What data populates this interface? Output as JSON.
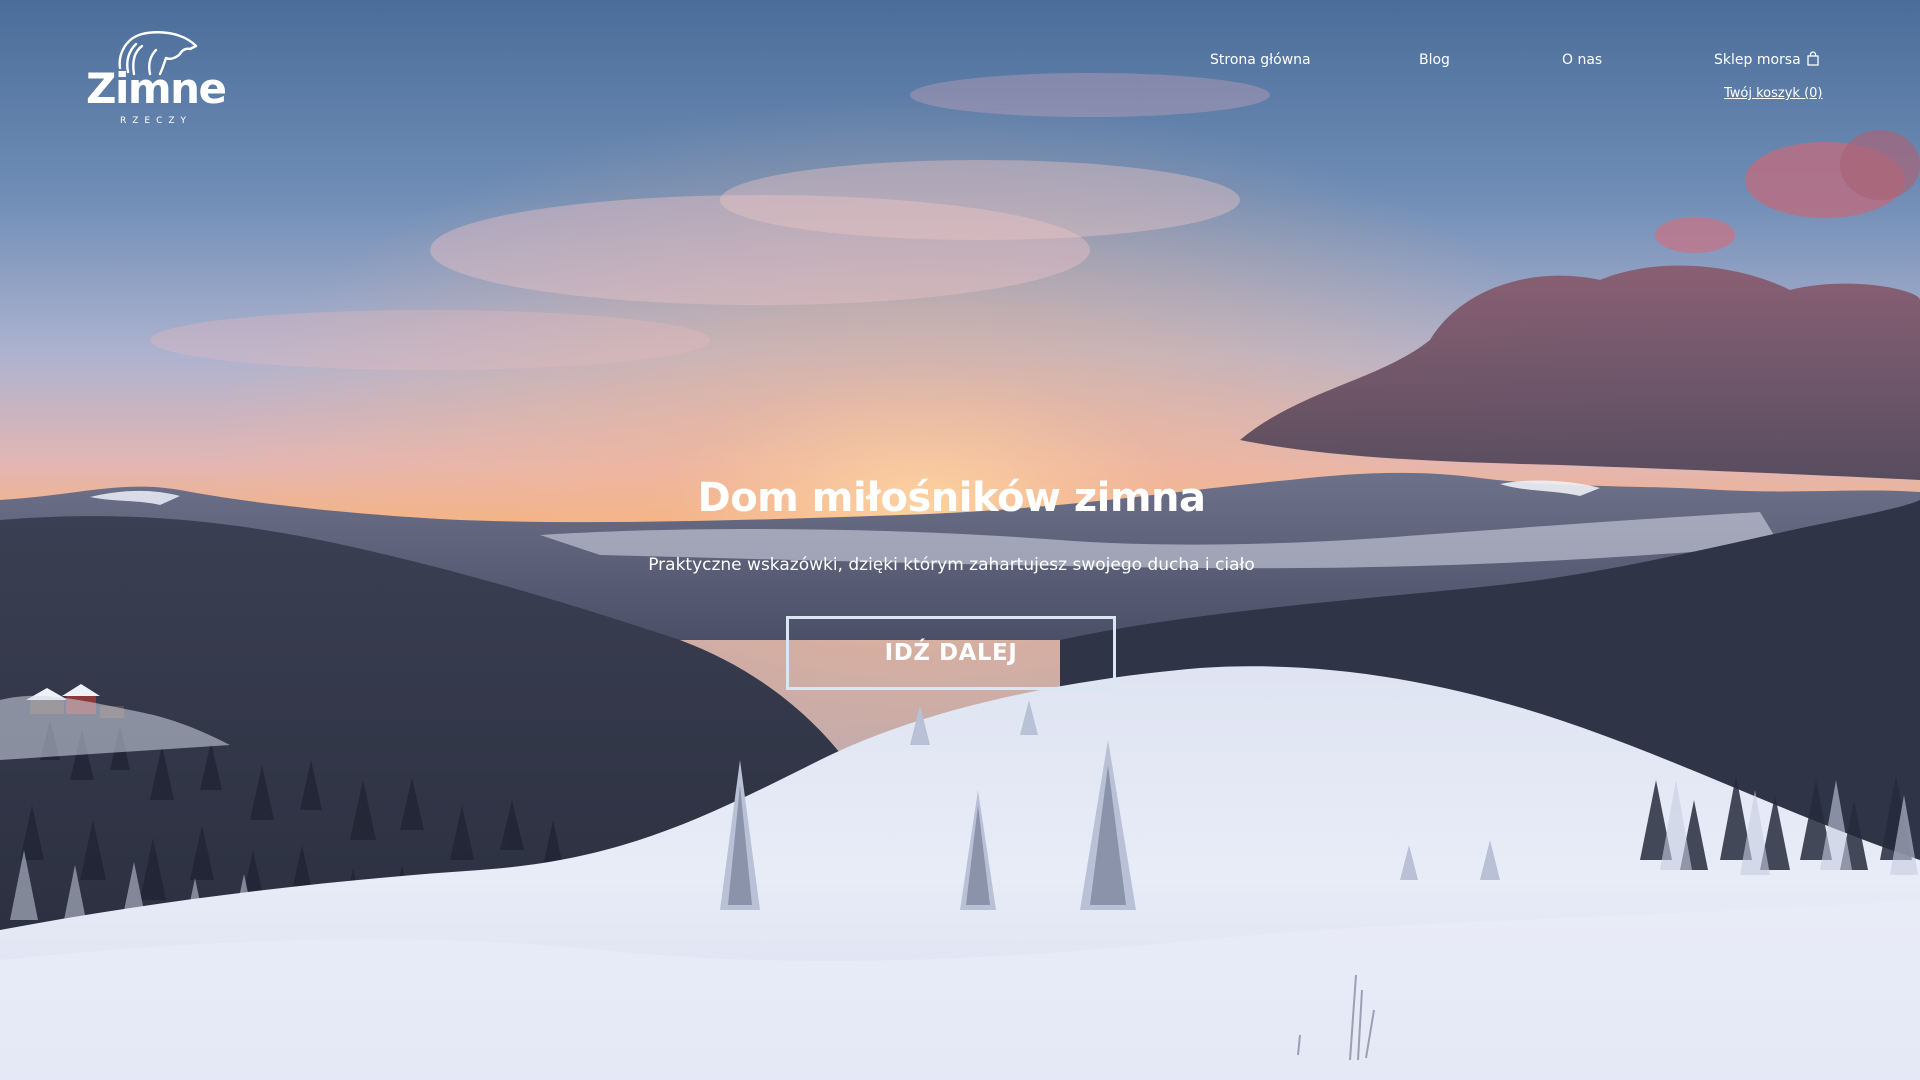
{
  "brand": {
    "name": "Zimne",
    "tagline": "RZECZY"
  },
  "nav": {
    "items": [
      {
        "label": "Strona główna"
      },
      {
        "label": "Blog"
      },
      {
        "label": "O nas"
      },
      {
        "label": "Sklep morsa",
        "icon": "shopping-bag-icon"
      }
    ],
    "cart_label": "Twój koszyk (0)"
  },
  "hero": {
    "title": "Dom miłośników zimna",
    "subtitle": "Praktyczne wskazówki, dzięki którym zahartujesz swojego ducha i ciało",
    "cta_label": "IDŹ DALEJ"
  },
  "colors": {
    "text": "#ffffff",
    "cta_border": "#dbe6f3",
    "sky_top": "#4a6d99",
    "sunset": "#f4b27e",
    "snow": "#e6ebf6"
  }
}
